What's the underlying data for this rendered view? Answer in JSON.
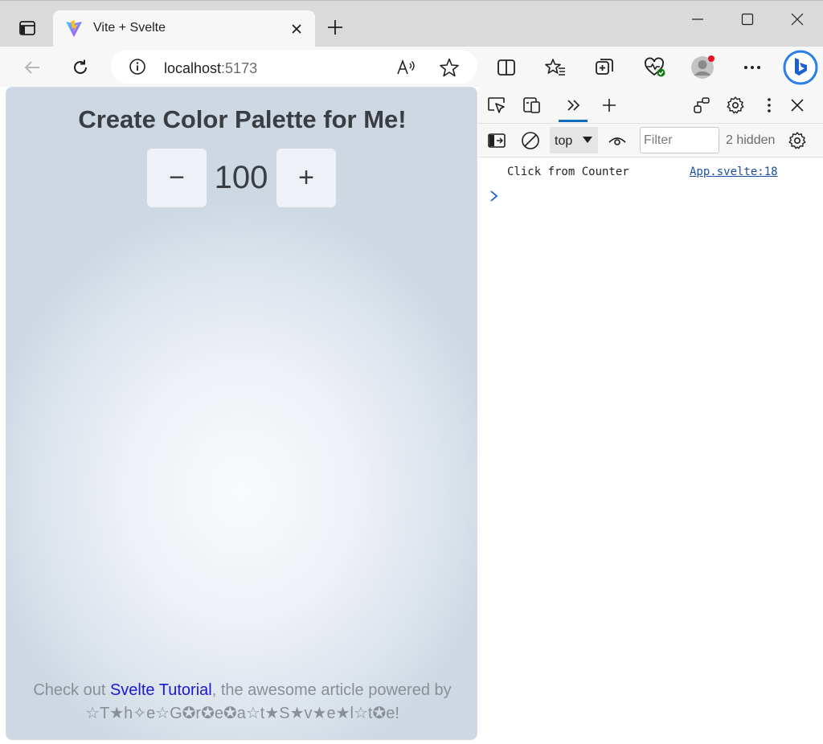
{
  "browser": {
    "tab": {
      "title": "Vite + Svelte"
    },
    "address": {
      "host": "localhost",
      "port": ":5173"
    }
  },
  "page": {
    "title": "Create Color Palette for Me!",
    "counter": {
      "decrement": "−",
      "value": "100",
      "increment": "+"
    },
    "footer": {
      "prefix": "Check out ",
      "link_text": "Svelte Tutorial",
      "suffix": ", the awesome article powered by",
      "line2": "☆T★h✧e☆G✪r✪e✪a☆t★S★v★e★l☆t✪e!"
    }
  },
  "devtools": {
    "context": "top",
    "filter_placeholder": "Filter",
    "hidden_count": "2 hidden",
    "console": [
      {
        "message": "Click from Counter",
        "source": "App.svelte:18"
      }
    ]
  },
  "colors": {
    "accent": "#0f6cbd",
    "link": "#1a1ad6",
    "title_text": "#3a3d42",
    "footer_text": "#8a8f96"
  }
}
